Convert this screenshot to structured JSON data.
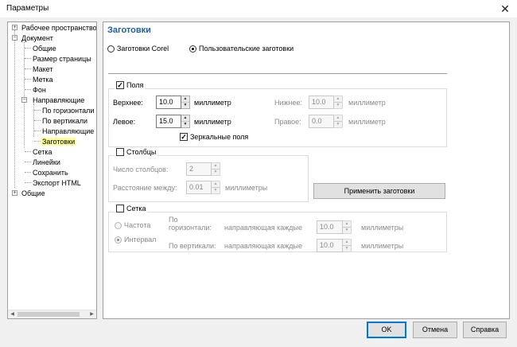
{
  "window": {
    "title": "Параметры",
    "close_glyph": "✕"
  },
  "tree": {
    "items": [
      {
        "label": "Рабочее пространство",
        "level": 0,
        "expander": "+"
      },
      {
        "label": "Документ",
        "level": 0,
        "expander": "−"
      },
      {
        "label": "Общие",
        "level": 1
      },
      {
        "label": "Размер страницы",
        "level": 1
      },
      {
        "label": "Макет",
        "level": 1
      },
      {
        "label": "Метка",
        "level": 1
      },
      {
        "label": "Фон",
        "level": 1
      },
      {
        "label": "Направляющие",
        "level": 1,
        "expander": "−"
      },
      {
        "label": "По горизонтали",
        "level": 2
      },
      {
        "label": "По вертикали",
        "level": 2
      },
      {
        "label": "Направляющие",
        "level": 2
      },
      {
        "label": "Заготовки",
        "level": 2,
        "selected": true
      },
      {
        "label": "Сетка",
        "level": 1
      },
      {
        "label": "Линейки",
        "level": 1
      },
      {
        "label": "Сохранить",
        "level": 1
      },
      {
        "label": "Экспорт HTML",
        "level": 1
      },
      {
        "label": "Общие",
        "level": 0,
        "expander": "+"
      }
    ],
    "scroll_left": "◀",
    "scroll_right": "▶"
  },
  "panel": {
    "title": "Заготовки",
    "preset_corel": "Заготовки Corel",
    "preset_user": "Пользовательские заготовки",
    "selected_preset": "Пользовательские заготовки",
    "margins": {
      "label": "Поля",
      "checked": true,
      "top_label": "Верхнее:",
      "top_value": "10.0",
      "top_unit": "миллиметр",
      "left_label": "Левое:",
      "left_value": "15.0",
      "left_unit": "миллиметр",
      "bottom_label": "Нижнее:",
      "bottom_value": "10.0",
      "bottom_unit": "миллиметр",
      "right_label": "Правое:",
      "right_value": "0.0",
      "right_unit": "миллиметр",
      "mirror_label": "Зеркальные поля",
      "mirror_checked": true
    },
    "columns": {
      "label": "Столбцы",
      "checked": false,
      "count_label": "Число столбцов:",
      "count_value": "2",
      "spacing_label": "Расстояние между:",
      "spacing_value": "0.01",
      "spacing_unit": "миллиметры"
    },
    "apply_button": "Применить заготовки",
    "grid": {
      "label": "Сетка",
      "checked": false,
      "frequency_label": "Частота",
      "interval_label": "Интервал",
      "selected_mode": "Интервал",
      "horizontal_label_1": "По",
      "horizontal_label_2": "горизонтали:",
      "vertical_label": "По вертикали:",
      "every_label_h": "направляющая каждые",
      "every_label_v": "направляющая каждые",
      "h_value": "10.0",
      "v_value": "10.0",
      "h_unit": "миллиметры",
      "v_unit": "миллиметры"
    }
  },
  "footer": {
    "ok": "OK",
    "cancel": "Отмена",
    "help": "Справка"
  },
  "icons": {
    "checkmark": "✓",
    "spin_up": "▲",
    "spin_down": "▼"
  }
}
